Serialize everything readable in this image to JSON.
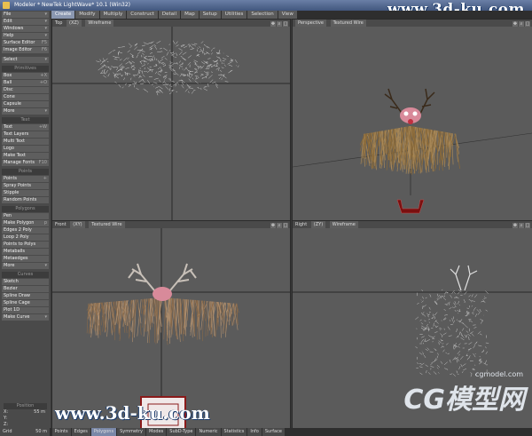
{
  "window": {
    "title": "Modeler * NewTek LightWave* 10.1 (Win32)"
  },
  "watermark": {
    "top": "www.3d-ku.com",
    "bottom": "www.3d-ku.com",
    "logo": "CG模型网",
    "logo_url": "cgmodel.com"
  },
  "tabs": [
    "Create",
    "Modify",
    "Multiply",
    "Construct",
    "Detail",
    "Map",
    "Setup",
    "Utilities",
    "Selection",
    "View"
  ],
  "sidebar": {
    "top": [
      {
        "label": "File",
        "sc": "▾"
      },
      {
        "label": "Edit",
        "sc": "▾"
      },
      {
        "label": "Windows",
        "sc": "▾"
      },
      {
        "label": "Help",
        "sc": "▾"
      },
      {
        "label": "Surface Editor",
        "sc": "F5"
      },
      {
        "label": "Image Editor",
        "sc": "F6"
      },
      {
        "label": "Select",
        "sc": "▾"
      }
    ],
    "primitives": {
      "head": "Primitives",
      "items": [
        {
          "label": "Box",
          "sc": "+X"
        },
        {
          "label": "Ball",
          "sc": "+O"
        },
        {
          "label": "Disc",
          "sc": ""
        },
        {
          "label": "Cone",
          "sc": ""
        },
        {
          "label": "Capsule",
          "sc": ""
        },
        {
          "label": "More",
          "sc": "▾"
        }
      ]
    },
    "text": {
      "head": "Text",
      "items": [
        {
          "label": "Text",
          "sc": "+W"
        },
        {
          "label": "Text Layers",
          "sc": ""
        },
        {
          "label": "Multi Text",
          "sc": ""
        },
        {
          "label": "Logo",
          "sc": ""
        },
        {
          "label": "Make Text",
          "sc": ""
        },
        {
          "label": "Manage Fonts",
          "sc": "F10"
        }
      ]
    },
    "points": {
      "head": "Points",
      "items": [
        {
          "label": "Points",
          "sc": "+"
        },
        {
          "label": "Spray Points",
          "sc": ""
        },
        {
          "label": "Stipple",
          "sc": ""
        },
        {
          "label": "Random Points",
          "sc": ""
        }
      ]
    },
    "polygons": {
      "head": "Polygons",
      "items": [
        {
          "label": "Pen",
          "sc": ""
        },
        {
          "label": "Make Polygon",
          "sc": "p"
        },
        {
          "label": "Edges 2 Poly",
          "sc": ""
        },
        {
          "label": "Loop 2 Poly",
          "sc": ""
        },
        {
          "label": "Points to Polys",
          "sc": ""
        },
        {
          "label": "Metaballs",
          "sc": ""
        },
        {
          "label": "Metaedges",
          "sc": ""
        },
        {
          "label": "More",
          "sc": "▾"
        }
      ]
    },
    "curves": {
      "head": "Curves",
      "items": [
        {
          "label": "Sketch",
          "sc": ""
        },
        {
          "label": "Bezier",
          "sc": ""
        },
        {
          "label": "Spline Draw",
          "sc": ""
        },
        {
          "label": "Spline Cage",
          "sc": ""
        },
        {
          "label": "Plot 1D",
          "sc": ""
        },
        {
          "label": "Make Curve",
          "sc": "▾"
        }
      ]
    },
    "position": {
      "head": "Position",
      "x": "55 m",
      "y": "",
      "z": "",
      "grid_label": "Grid",
      "grid": "50 m"
    }
  },
  "viewports": [
    {
      "view": "Top",
      "axis": "(XZ)",
      "mode": "Wireframe"
    },
    {
      "view": "Perspective",
      "axis": "",
      "mode": "Textured Wire"
    },
    {
      "view": "Front",
      "axis": "(XY)",
      "mode": "Textured Wire"
    },
    {
      "view": "Right",
      "axis": "(ZY)",
      "mode": "Wireframe"
    }
  ],
  "statusbar": [
    "Points",
    "Edges",
    "Polygons",
    "Symmetry",
    "Modes",
    "SubD-Type",
    "Numeric",
    "Statistics",
    "Info",
    "Surface"
  ],
  "colors": {
    "accent": "#7a88a8",
    "fur": "#8a6a3a",
    "wire": "#dddddd",
    "antler": "#c8c0b8",
    "nose": "#d88a9a",
    "base": "#8a1a1a"
  }
}
